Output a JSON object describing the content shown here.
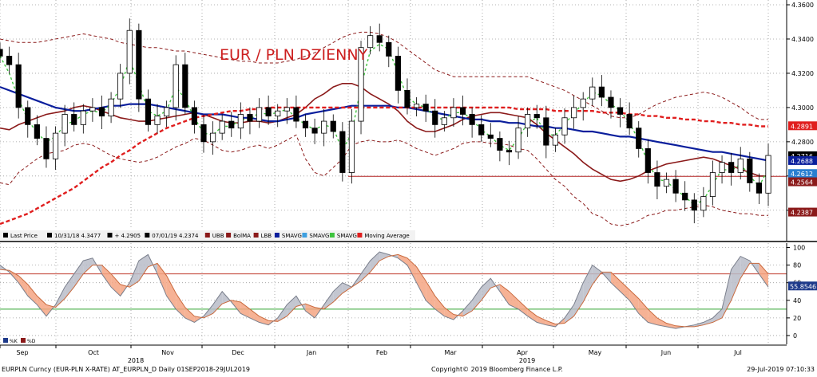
{
  "chart_data": [
    {
      "type": "line",
      "title": "EUR / PLN DZIENNY",
      "ylim": [
        4.225,
        4.36
      ],
      "y_ticks": [
        "4.3600",
        "4.3400",
        "4.3200",
        "4.3000",
        "4.2800",
        "4.2600",
        "4.2400"
      ],
      "x_labels": [
        "Sep",
        "Oct",
        "Nov",
        "Dec",
        "Jan",
        "Feb",
        "Mar",
        "Apr",
        "May",
        "Jun",
        "Jul"
      ],
      "year_labels": [
        "2018",
        "2019"
      ],
      "series": [
        {
          "name": "Last Price",
          "color": "#000000",
          "values": [
            4.33,
            4.325,
            4.3,
            4.29,
            4.282,
            4.27,
            4.285,
            4.296,
            4.29,
            4.298,
            4.3,
            4.295,
            4.305,
            4.32,
            4.345,
            4.305,
            4.29,
            4.295,
            4.3,
            4.325,
            4.3,
            4.29,
            4.28,
            4.285,
            4.292,
            4.288,
            4.296,
            4.292,
            4.3,
            4.295,
            4.298,
            4.3,
            4.292,
            4.288,
            4.285,
            4.292,
            4.286,
            4.262,
            4.292,
            4.335,
            4.342,
            4.338,
            4.33,
            4.31,
            4.3,
            4.302,
            4.298,
            4.29,
            4.294,
            4.3,
            4.296,
            4.29,
            4.284,
            4.282,
            4.275,
            4.274,
            4.288,
            4.296,
            4.294,
            4.278,
            4.284,
            4.294,
            4.3,
            4.305,
            4.312,
            4.306,
            4.3,
            4.296,
            4.288,
            4.276,
            4.262,
            4.254,
            4.258,
            4.25,
            4.246,
            4.24,
            4.248,
            4.262,
            4.268,
            4.262,
            4.27,
            4.256,
            4.25,
            4.272
          ]
        },
        {
          "name": "BolMA",
          "color": "#8b1a1a",
          "values": [
            4.288,
            4.287,
            4.29,
            4.292,
            4.294,
            4.296,
            4.297,
            4.298,
            4.3,
            4.301,
            4.3,
            4.298,
            4.296,
            4.294,
            4.293,
            4.292,
            4.292,
            4.293,
            4.294,
            4.295,
            4.296,
            4.297,
            4.296,
            4.294,
            4.292,
            4.291,
            4.291,
            4.292,
            4.292,
            4.291,
            4.292,
            4.294,
            4.296,
            4.3,
            4.305,
            4.308,
            4.312,
            4.314,
            4.314,
            4.312,
            4.308,
            4.305,
            4.302,
            4.298,
            4.292,
            4.288,
            4.286,
            4.286,
            4.288,
            4.29,
            4.293,
            4.295,
            4.296,
            4.297,
            4.297,
            4.296,
            4.295,
            4.294,
            4.29,
            4.285,
            4.281,
            4.277,
            4.273,
            4.268,
            4.264,
            4.261,
            4.258,
            4.257,
            4.258,
            4.26,
            4.263,
            4.265,
            4.267,
            4.268,
            4.269,
            4.27,
            4.271,
            4.27,
            4.268,
            4.266,
            4.264,
            4.262,
            4.26,
            4.26
          ]
        },
        {
          "name": "SMAVG",
          "color": "#0a1e9c",
          "values": [
            4.312,
            4.31,
            4.308,
            4.306,
            4.304,
            4.302,
            4.3,
            4.299,
            4.298,
            4.298,
            4.299,
            4.3,
            4.301,
            4.301,
            4.302,
            4.302,
            4.302,
            4.301,
            4.3,
            4.299,
            4.298,
            4.297,
            4.296,
            4.296,
            4.296,
            4.295,
            4.294,
            4.294,
            4.293,
            4.292,
            4.292,
            4.293,
            4.294,
            4.296,
            4.297,
            4.298,
            4.299,
            4.3,
            4.301,
            4.301,
            4.301,
            4.301,
            4.301,
            4.3,
            4.3,
            4.299,
            4.298,
            4.297,
            4.296,
            4.295,
            4.294,
            4.293,
            4.293,
            4.292,
            4.292,
            4.291,
            4.291,
            4.29,
            4.289,
            4.289,
            4.288,
            4.288,
            4.287,
            4.286,
            4.286,
            4.285,
            4.284,
            4.283,
            4.283,
            4.282,
            4.281,
            4.28,
            4.279,
            4.278,
            4.277,
            4.276,
            4.275,
            4.274,
            4.274,
            4.273,
            4.272,
            4.271,
            4.27,
            4.269
          ]
        },
        {
          "name": "SMAVG",
          "color": "#3ec43e",
          "values": [
            4.33,
            4.32,
            4.305,
            4.293,
            4.285,
            4.28,
            4.283,
            4.29,
            4.292,
            4.296,
            4.298,
            4.297,
            4.302,
            4.312,
            4.328,
            4.314,
            4.298,
            4.295,
            4.298,
            4.312,
            4.305,
            4.294,
            4.285,
            4.284,
            4.289,
            4.289,
            4.293,
            4.293,
            4.297,
            4.296,
            4.297,
            4.299,
            4.294,
            4.29,
            4.287,
            4.29,
            4.288,
            4.275,
            4.285,
            4.312,
            4.333,
            4.337,
            4.334,
            4.32,
            4.306,
            4.302,
            4.3,
            4.294,
            4.293,
            4.297,
            4.297,
            4.293,
            4.287,
            4.283,
            4.278,
            4.275,
            4.282,
            4.291,
            4.294,
            4.284,
            4.284,
            4.29,
            4.297,
            4.302,
            4.309,
            4.307,
            4.302,
            4.298,
            4.291,
            4.281,
            4.268,
            4.258,
            4.257,
            4.252,
            4.248,
            4.243,
            4.246,
            4.255,
            4.264,
            4.263,
            4.267,
            4.26,
            4.254,
            4.264
          ]
        },
        {
          "name": "Moving Average",
          "color": "#e01e1e",
          "values": [
            4.232,
            4.234,
            4.236,
            4.238,
            4.241,
            4.244,
            4.247,
            4.25,
            4.253,
            4.257,
            4.261,
            4.265,
            4.268,
            4.272,
            4.275,
            4.279,
            4.282,
            4.285,
            4.288,
            4.29,
            4.292,
            4.294,
            4.295,
            4.296,
            4.297,
            4.298,
            4.298,
            4.299,
            4.299,
            4.3,
            4.3,
            4.3,
            4.3,
            4.3,
            4.3,
            4.3,
            4.3,
            4.3,
            4.3,
            4.3,
            4.3,
            4.3,
            4.3,
            4.3,
            4.3,
            4.3,
            4.3,
            4.3,
            4.3,
            4.3,
            4.3,
            4.3,
            4.3,
            4.3,
            4.3,
            4.3,
            4.299,
            4.299,
            4.299,
            4.299,
            4.298,
            4.298,
            4.298,
            4.298,
            4.298,
            4.297,
            4.297,
            4.297,
            4.296,
            4.296,
            4.295,
            4.295,
            4.294,
            4.294,
            4.293,
            4.293,
            4.292,
            4.292,
            4.291,
            4.291,
            4.29,
            4.29,
            4.289,
            4.289
          ]
        },
        {
          "name": "UBB",
          "color": "#8b1a1a",
          "values": [
            4.34,
            4.339,
            4.338,
            4.338,
            4.338,
            4.339,
            4.34,
            4.341,
            4.342,
            4.343,
            4.342,
            4.341,
            4.34,
            4.338,
            4.337,
            4.336,
            4.335,
            4.335,
            4.334,
            4.333,
            4.333,
            4.332,
            4.331,
            4.33,
            4.329,
            4.328,
            4.327,
            4.327,
            4.326,
            4.326,
            4.326,
            4.327,
            4.328,
            4.33,
            4.332,
            4.335,
            4.338,
            4.341,
            4.343,
            4.344,
            4.344,
            4.343,
            4.341,
            4.338,
            4.334,
            4.33,
            4.326,
            4.322,
            4.32,
            4.318,
            4.318,
            4.318,
            4.318,
            4.318,
            4.318,
            4.318,
            4.318,
            4.318,
            4.316,
            4.314,
            4.312,
            4.31,
            4.307,
            4.304,
            4.301,
            4.298,
            4.295,
            4.294,
            4.294,
            4.296,
            4.299,
            4.302,
            4.304,
            4.306,
            4.307,
            4.308,
            4.309,
            4.308,
            4.306,
            4.303,
            4.3,
            4.296,
            4.293,
            4.293
          ]
        },
        {
          "name": "LBB",
          "color": "#8b1a1a",
          "values": [
            4.256,
            4.255,
            4.262,
            4.266,
            4.27,
            4.273,
            4.274,
            4.275,
            4.278,
            4.279,
            4.278,
            4.275,
            4.272,
            4.27,
            4.269,
            4.268,
            4.269,
            4.271,
            4.274,
            4.277,
            4.279,
            4.282,
            4.281,
            4.278,
            4.275,
            4.274,
            4.275,
            4.277,
            4.278,
            4.276,
            4.278,
            4.281,
            4.284,
            4.27,
            4.262,
            4.26,
            4.265,
            4.27,
            4.278,
            4.28,
            4.281,
            4.28,
            4.28,
            4.281,
            4.279,
            4.276,
            4.274,
            4.272,
            4.274,
            4.276,
            4.279,
            4.28,
            4.28,
            4.279,
            4.279,
            4.278,
            4.276,
            4.275,
            4.27,
            4.264,
            4.258,
            4.254,
            4.248,
            4.244,
            4.238,
            4.236,
            4.232,
            4.231,
            4.232,
            4.234,
            4.237,
            4.238,
            4.24,
            4.24,
            4.241,
            4.242,
            4.243,
            4.242,
            4.24,
            4.239,
            4.238,
            4.238,
            4.237,
            4.237
          ]
        }
      ],
      "price_labels": [
        {
          "text": "4.2891",
          "color": "#e01e1e",
          "value": 4.2891
        },
        {
          "text": "4.2716",
          "color": "#000000",
          "value": 4.2716
        },
        {
          "text": "4.2688",
          "color": "#0a1e9c",
          "value": 4.2688
        },
        {
          "text": "4.2612",
          "color": "#2a7fd0",
          "value": 4.2612
        },
        {
          "text": "4.2564",
          "color": "#8b1a1a",
          "value": 4.2564
        },
        {
          "text": "4.2387",
          "color": "#8b1a1a",
          "value": 4.2387
        }
      ],
      "support_level": 4.2598,
      "legend": [
        {
          "text": "Last Price",
          "color": "#000000"
        },
        {
          "text": "10/31/18 4.3477",
          "color": "#000000"
        },
        {
          "text": "+ 4.2905",
          "color": "#000000"
        },
        {
          "text": "07/01/19 4.2374",
          "color": "#000000"
        },
        {
          "text": "UBB",
          "color": "#8b1a1a"
        },
        {
          "text": "BolMA",
          "color": "#8b1a1a"
        },
        {
          "text": "LBB",
          "color": "#8b1a1a"
        },
        {
          "text": "SMAVG",
          "color": "#0a1e9c"
        },
        {
          "text": "SMAVG",
          "color": "#3ea0e0"
        },
        {
          "text": "SMAVG",
          "color": "#3ec43e"
        },
        {
          "text": "Moving Average",
          "color": "#e01e1e"
        }
      ]
    },
    {
      "type": "line",
      "ylim": [
        -10,
        105
      ],
      "y_ticks": [
        "100",
        "80",
        "60",
        "40",
        "20",
        "0"
      ],
      "last_value_label": "55.8546",
      "upper_level": 70,
      "lower_level": 30,
      "series": [
        {
          "name": "%K",
          "color": "#1e3a8a",
          "values": [
            80,
            72,
            60,
            45,
            35,
            22,
            35,
            55,
            70,
            85,
            88,
            70,
            55,
            45,
            60,
            85,
            92,
            70,
            45,
            30,
            20,
            15,
            22,
            35,
            50,
            38,
            25,
            20,
            15,
            12,
            20,
            35,
            45,
            28,
            20,
            35,
            50,
            60,
            55,
            70,
            85,
            95,
            92,
            88,
            80,
            60,
            40,
            30,
            22,
            18,
            28,
            40,
            55,
            65,
            50,
            35,
            30,
            22,
            15,
            12,
            10,
            20,
            35,
            60,
            80,
            72,
            60,
            50,
            40,
            25,
            15,
            12,
            10,
            8,
            10,
            12,
            15,
            20,
            30,
            75,
            90,
            85,
            70,
            55
          ]
        },
        {
          "name": "%D",
          "color": "#8b1a1a",
          "values": [
            75,
            74,
            68,
            58,
            45,
            35,
            32,
            42,
            55,
            70,
            80,
            80,
            70,
            58,
            55,
            62,
            78,
            82,
            68,
            48,
            32,
            22,
            20,
            25,
            36,
            40,
            38,
            30,
            22,
            17,
            16,
            22,
            33,
            36,
            32,
            30,
            38,
            48,
            55,
            62,
            72,
            85,
            90,
            92,
            88,
            78,
            62,
            45,
            32,
            24,
            22,
            28,
            40,
            54,
            58,
            50,
            40,
            30,
            22,
            17,
            13,
            14,
            22,
            38,
            58,
            72,
            72,
            62,
            52,
            42,
            30,
            20,
            14,
            11,
            10,
            10,
            12,
            15,
            20,
            40,
            65,
            82,
            82,
            70
          ]
        }
      ]
    }
  ],
  "footer": {
    "left": "EURPLN Curncy (EUR-PLN X-RATE) AT_EURPLN_D  Daily 01SEP2018-29JUL2019",
    "center": "Copyright© 2019 Bloomberg Finance L.P.",
    "right": "29-Jul-2019 07:10:33"
  },
  "sub_legend": [
    {
      "text": "%K",
      "color": "#1e3a8a"
    },
    {
      "text": "%D",
      "color": "#8b1a1a"
    }
  ]
}
